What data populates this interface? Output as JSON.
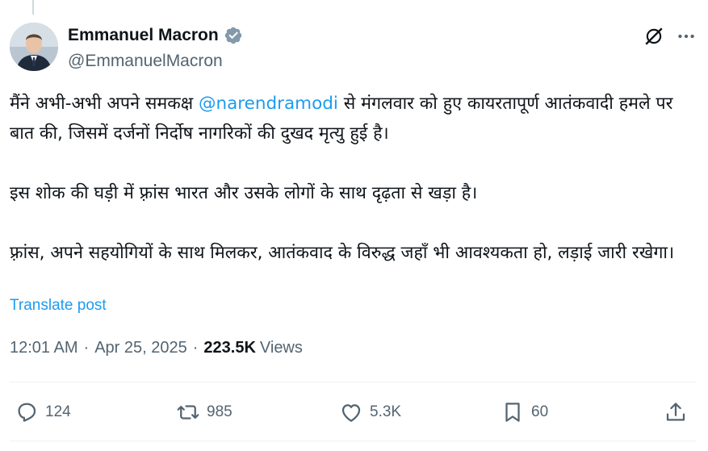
{
  "author": {
    "name": "Emmanuel Macron",
    "handle": "@EmmanuelMacron",
    "verified": true
  },
  "tweet": {
    "para1_before": "मैंने अभी-अभी अपने समकक्ष ",
    "mention": "@narendramodi",
    "para1_after": " से मंगलवार को हुए कायरतापूर्ण आतंकवादी हमले पर बात की, जिसमें दर्जनों निर्दोष नागरिकों की दुखद मृत्यु हुई है।",
    "para2": "इस शोक की घड़ी में फ़्रांस भारत और उसके लोगों के साथ दृढ़ता से खड़ा है।",
    "para3": "फ़्रांस, अपने सहयोगियों के साथ मिलकर, आतंकवाद के विरुद्ध जहाँ भी आवश्यकता हो, लड़ाई जारी रखेगा।"
  },
  "translate_label": "Translate post",
  "meta": {
    "time": "12:01 AM",
    "date": "Apr 25, 2025",
    "separator": "·",
    "views_count": "223.5K",
    "views_label": "Views"
  },
  "actions": {
    "replies": "124",
    "reposts": "985",
    "likes": "5.3K",
    "bookmarks": "60"
  },
  "icons": [
    "grok-icon",
    "more-icon",
    "verified-icon",
    "reply-icon",
    "repost-icon",
    "like-icon",
    "bookmark-icon",
    "share-icon"
  ],
  "colors": {
    "accent": "#1d9bf0",
    "secondary_text": "#536471",
    "primary_text": "#0f1419"
  }
}
